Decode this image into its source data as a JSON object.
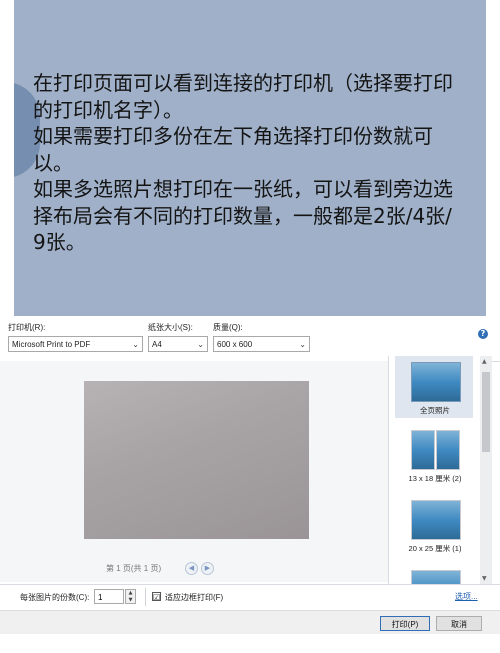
{
  "instructions": {
    "lines": [
      "在打印页面可以看到连接的打印机（选择要打印",
      "的打印机名字）。",
      "如果需要打印多份在左下角选择打印份数就可",
      "以。",
      "如果多选照片想打印在一张纸，可以看到旁边选",
      "择布局会有不同的打印数量，一般都是2张/4张/",
      "9张。"
    ]
  },
  "dialog": {
    "printer_label": "打印机(R):",
    "printer_value": "Microsoft Print to PDF",
    "paper_label": "纸张大小(S):",
    "paper_value": "A4",
    "quality_label": "质量(Q):",
    "quality_value": "600 x 600",
    "help": "?",
    "page_nav": "第 1 页(共 1 页)",
    "layouts": [
      {
        "label": "全页照片",
        "selected": true
      },
      {
        "label": "13 x 18 厘米 (2)",
        "selected": false
      },
      {
        "label": "20 x 25 厘米 (1)",
        "selected": false
      },
      {
        "label": "",
        "selected": false
      }
    ],
    "copies_label": "每张图片的份数(C):",
    "copies_value": "1",
    "fit_label": "适应边框打印(F)",
    "fit_checked": "☑",
    "options_link": "选项...",
    "print_button": "打印(P)",
    "cancel_button": "取消"
  },
  "colors": {
    "panel_bg": "#9fb0c8",
    "accent": "#2f6db5"
  }
}
